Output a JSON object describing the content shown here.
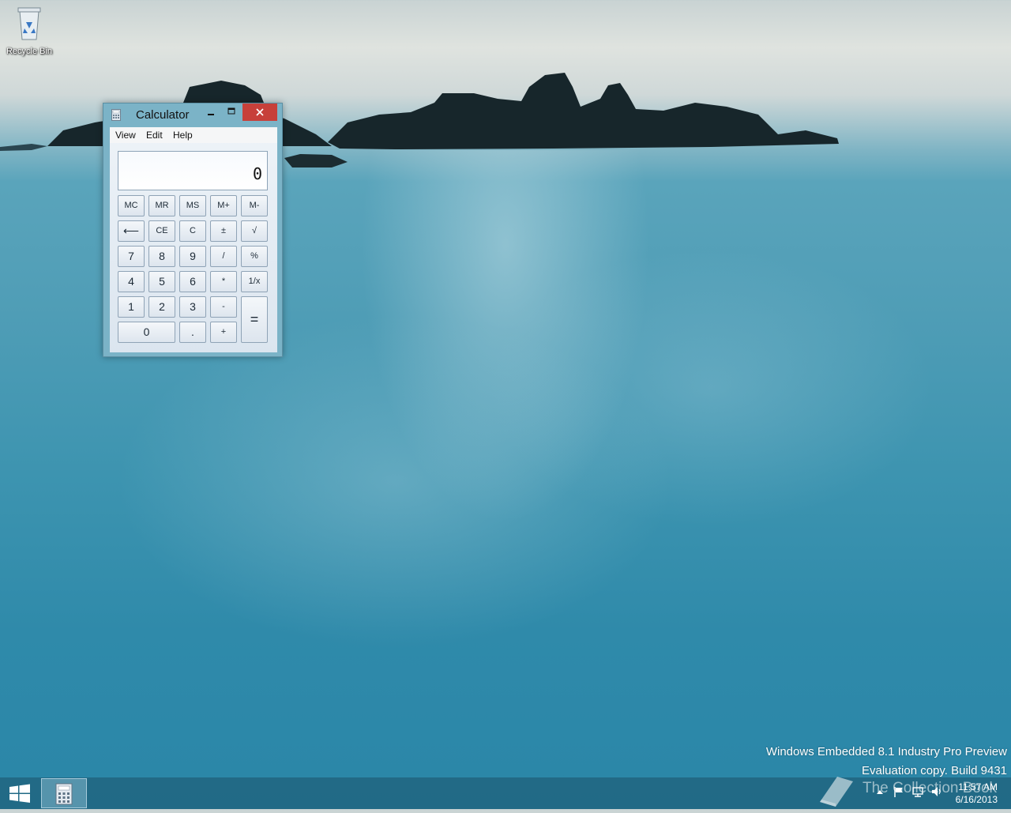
{
  "desktop": {
    "recycle_bin_label": "Recycle Bin",
    "watermark_line1": "Windows Embedded 8.1 Industry Pro Preview",
    "watermark_line2": "Evaluation copy. Build 9431",
    "brand_text": "The Collection Book"
  },
  "calculator": {
    "title": "Calculator",
    "menu": [
      "View",
      "Edit",
      "Help"
    ],
    "display": "0",
    "keys": {
      "mc": "MC",
      "mr": "MR",
      "ms": "MS",
      "mplus": "M+",
      "mminus": "M-",
      "back": "⟵",
      "ce": "CE",
      "c": "C",
      "plusminus": "±",
      "sqrt": "√",
      "k7": "7",
      "k8": "8",
      "k9": "9",
      "div": "/",
      "pct": "%",
      "k4": "4",
      "k5": "5",
      "k6": "6",
      "mul": "*",
      "recip": "1/x",
      "k1": "1",
      "k2": "2",
      "k3": "3",
      "sub": "-",
      "eq": "=",
      "k0": "0",
      "dot": ".",
      "add": "+"
    }
  },
  "taskbar": {
    "time": "11:57 AM",
    "date": "6/16/2013"
  }
}
